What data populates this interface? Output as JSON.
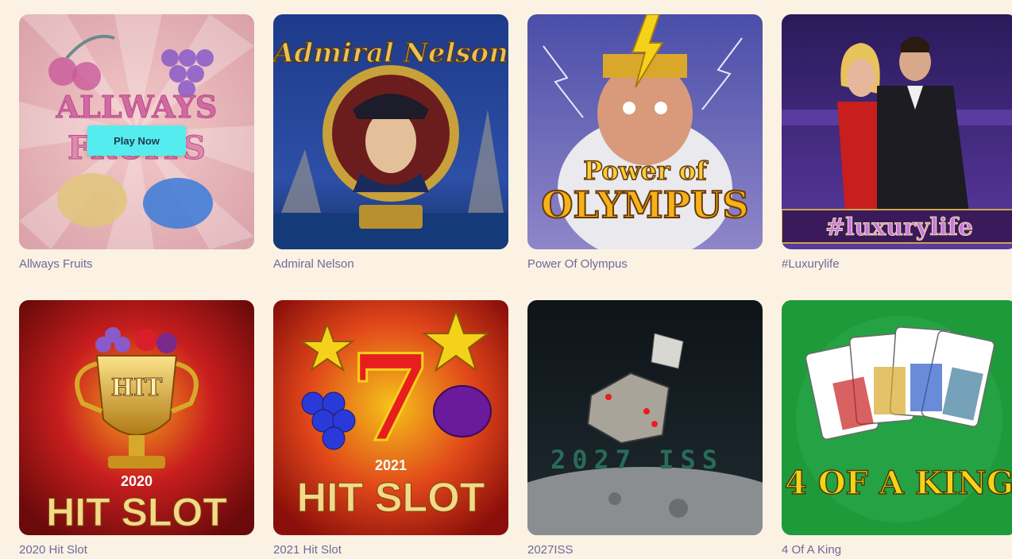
{
  "games": [
    {
      "name": "Allways Fruits",
      "art_text": [
        "ALLWAYS",
        "FRUITS"
      ],
      "play_label": "Play Now"
    },
    {
      "name": "Admiral Nelson",
      "art_text": [
        "Admiral Nelson"
      ]
    },
    {
      "name": "Power Of Olympus",
      "art_text": [
        "Power of",
        "OLYMPUS"
      ]
    },
    {
      "name": "#Luxurylife",
      "art_text": [
        "#luxurylife"
      ]
    },
    {
      "name": "2020 Hit Slot",
      "art_text": [
        "HIT",
        "2020",
        "HIT SLOT"
      ]
    },
    {
      "name": "2021 Hit Slot",
      "art_text": [
        "7",
        "2021",
        "HIT SLOT"
      ]
    },
    {
      "name": "2027ISS",
      "art_text": [
        "2027 ISS"
      ]
    },
    {
      "name": "4 Of A King",
      "art_text": [
        "4 OF A KING"
      ]
    }
  ],
  "colors": {
    "page_bg": "#fbf2e3",
    "caption": "#6b6a9a",
    "play_button": "#55ecf0"
  }
}
